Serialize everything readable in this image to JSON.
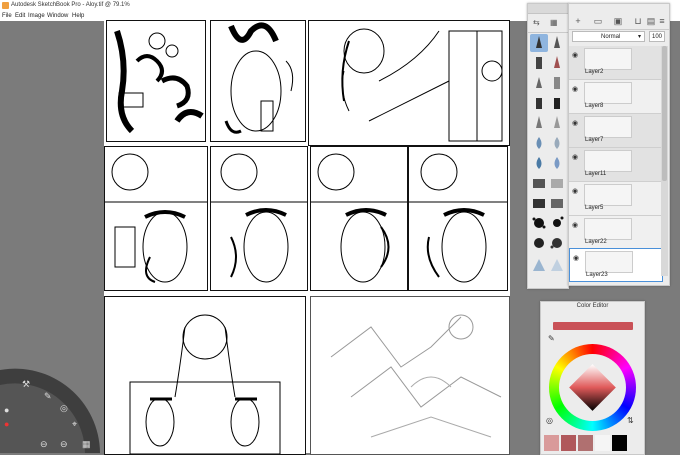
{
  "window": {
    "title": "Autodesk SketchBook Pro - Aloy.tif @ 79.1%"
  },
  "menu": [
    "File",
    "Edit",
    "Image",
    "Window",
    "Help"
  ],
  "layers": {
    "blend_mode": "Normal",
    "opacity": "100",
    "items": [
      {
        "name": "Layer2",
        "visible": true
      },
      {
        "name": "Layer8",
        "visible": true
      },
      {
        "name": "Layer7",
        "visible": true
      },
      {
        "name": "Layer11",
        "visible": true
      },
      {
        "name": "Layer5",
        "visible": true
      },
      {
        "name": "Layer22",
        "visible": true
      },
      {
        "name": "Layer23",
        "visible": true,
        "selected": true
      }
    ]
  },
  "color_editor": {
    "title": "Color Editor",
    "current_color": "#c95157",
    "recent_colors": [
      "#d99a9a",
      "#b0585b",
      "#b07070",
      "#f5f5f5",
      "#000000"
    ]
  },
  "colors": {
    "workspace": "#7b7b7b",
    "selection": "#4a90d9"
  },
  "icons": {
    "layer_toolbar": [
      "add-layer-icon",
      "folder-icon",
      "image-icon",
      "merge-icon",
      "delete-icon",
      "menu-icon"
    ],
    "brush_tools": [
      "pencil-icon",
      "pen-icon",
      "marker-icon",
      "brush-icon",
      "airbrush-icon",
      "eraser-icon",
      "smudge-icon",
      "blur-icon",
      "fill-icon",
      "texture-icon",
      "splatter-icon",
      "triangle-icon"
    ]
  }
}
